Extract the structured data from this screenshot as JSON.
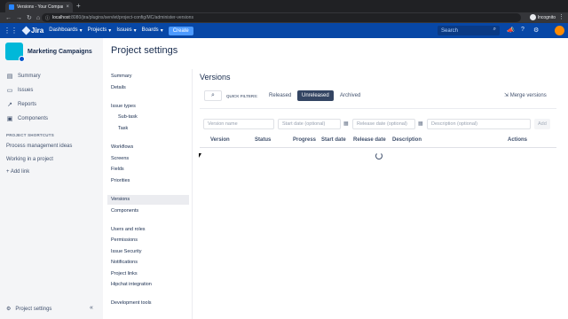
{
  "browser": {
    "tab_title": "Versions - Your Company Jira",
    "url_host": "localhost",
    "url_path": ":8080/jira/plugins/servlet/project-config/MC/administer-versions",
    "profile_label": "Incognito"
  },
  "jira_nav": {
    "logo": "Jira",
    "menu": [
      "Dashboards",
      "Projects",
      "Issues",
      "Boards"
    ],
    "create_label": "Create",
    "search_placeholder": "Search"
  },
  "sidebar": {
    "project_name": "Marketing Campaigns",
    "items": [
      {
        "label": "Summary",
        "icon": "summary-icon"
      },
      {
        "label": "Issues",
        "icon": "issues-icon"
      },
      {
        "label": "Reports",
        "icon": "reports-icon"
      },
      {
        "label": "Components",
        "icon": "components-icon"
      }
    ],
    "shortcuts_heading": "PROJECT SHORTCUTS",
    "shortcuts": [
      "Process management ideas",
      "Working in a project"
    ],
    "add_link": "Add link",
    "footer_label": "Project settings"
  },
  "page": {
    "title": "Project settings"
  },
  "settings_nav": [
    {
      "label": "Summary"
    },
    {
      "label": "Details"
    },
    {
      "label": "Issue types"
    },
    {
      "label": "Sub-task"
    },
    {
      "label": "Task"
    },
    {
      "label": "Workflows"
    },
    {
      "label": "Screens"
    },
    {
      "label": "Fields"
    },
    {
      "label": "Priorities"
    },
    {
      "label": "Versions"
    },
    {
      "label": "Components"
    },
    {
      "label": "Users and roles"
    },
    {
      "label": "Permissions"
    },
    {
      "label": "Issue Security"
    },
    {
      "label": "Notifications"
    },
    {
      "label": "Project links"
    },
    {
      "label": "Hipchat integration"
    },
    {
      "label": "Development tools"
    }
  ],
  "versions": {
    "title": "Versions",
    "quick_filters_label": "QUICK FILTERS:",
    "filters": [
      "Released",
      "Unreleased",
      "Archived"
    ],
    "active_filter": "Unreleased",
    "merge_label": "Merge versions",
    "form": {
      "name_placeholder": "Version name",
      "start_placeholder": "Start date (optional)",
      "release_placeholder": "Release date (optional)",
      "description_placeholder": "Description (optional)",
      "add_label": "Add"
    },
    "columns": [
      "Version",
      "Status",
      "Progress",
      "Start date",
      "Release date",
      "Description",
      "Actions"
    ]
  }
}
